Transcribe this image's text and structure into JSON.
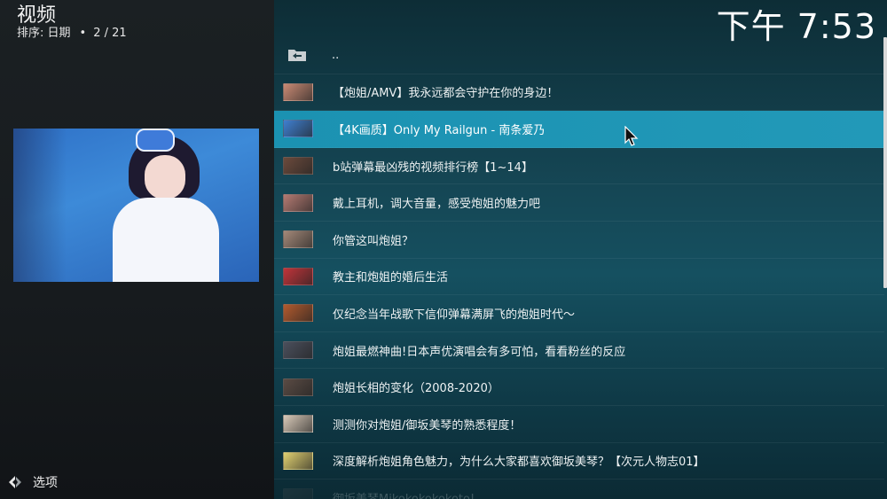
{
  "header": {
    "title": "视频",
    "sort_label": "排序: 日期",
    "dot": "•",
    "position": "2 / 21"
  },
  "clock": "下午 7:53",
  "sidebar": {
    "options_label": "选项"
  },
  "list": {
    "parent_label": "..",
    "items": [
      {
        "label": "【炮姐/AMV】我永远都会守护在你的身边！",
        "thumb_color": "#c98a74"
      },
      {
        "label": "【4K画质】Only My Railgun - 南条爱乃",
        "thumb_color": "#3f7fd0"
      },
      {
        "label": "b站弹幕最凶残的视频排行榜【1~14】",
        "thumb_color": "#6b4a3c"
      },
      {
        "label": "戴上耳机，调大音量，感受炮姐的魅力吧",
        "thumb_color": "#b47a72"
      },
      {
        "label": "你管这叫炮姐？",
        "thumb_color": "#a38878"
      },
      {
        "label": "教主和炮姐的婚后生活",
        "thumb_color": "#c0343a"
      },
      {
        "label": "仅纪念当年战歌下信仰弹幕满屏飞的炮姐时代～",
        "thumb_color": "#b25a2e"
      },
      {
        "label": "炮姐最燃神曲!日本声优演唱会有多可怕，看看粉丝的反应",
        "thumb_color": "#4a4f5c"
      },
      {
        "label": "炮姐长相的变化（2008-2020）",
        "thumb_color": "#5a4b44"
      },
      {
        "label": "测测你对炮姐/御坂美琴的熟悉程度！",
        "thumb_color": "#d8c9b8"
      },
      {
        "label": "深度解析炮姐角色魅力，为什么大家都喜欢御坂美琴？【次元人物志01】",
        "thumb_color": "#e0d070"
      },
      {
        "label": "御坂美琴Mikokokokokoto!",
        "thumb_color": "#555555"
      }
    ]
  },
  "colors": {
    "selected_row": "#1b92b2",
    "right_panel": "#155060",
    "left_panel": "#1b2023"
  }
}
